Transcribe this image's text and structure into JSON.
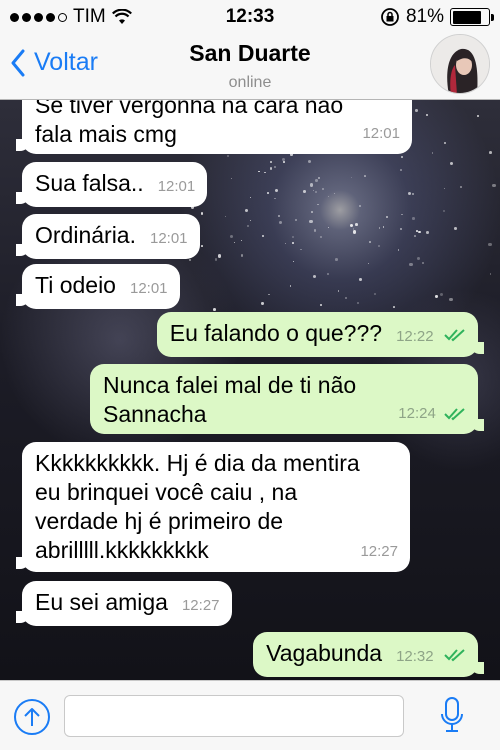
{
  "status_bar": {
    "carrier": "TIM",
    "time": "12:33",
    "battery": "81%",
    "battery_level": 0.81
  },
  "header": {
    "back_label": "Voltar",
    "contact_name": "San Duarte",
    "status": "online"
  },
  "messages": [
    {
      "direction": "in",
      "text": "Se tiver vergonha na cara não fala mais cmg",
      "line1": "Se tiver vergonha na cara não",
      "line2": "fala mais cmg",
      "time": "12:01"
    },
    {
      "direction": "in",
      "text": "Sua falsa..",
      "time": "12:01"
    },
    {
      "direction": "in",
      "text": "Ordinária.",
      "time": "12:01"
    },
    {
      "direction": "in",
      "text": "Ti odeio",
      "time": "12:01"
    },
    {
      "direction": "out",
      "text": "Eu falando o que???",
      "time": "12:22",
      "read": true
    },
    {
      "direction": "out",
      "line1": "Nunca falei mal de ti não",
      "line2": "Sannacha",
      "time": "12:24",
      "read": true
    },
    {
      "direction": "in",
      "line1": "Kkkkkkkkkk. Hj é dia da mentira",
      "line2": "eu brinquei você caiu , na",
      "line3": "verdade hj é primeiro de",
      "line4": "abrilllll.kkkkkkkkk",
      "time": "12:27"
    },
    {
      "direction": "in",
      "text": "Eu sei amiga",
      "time": "12:27"
    },
    {
      "direction": "out",
      "text": "Vagabunda",
      "time": "12:32",
      "read": true
    }
  ],
  "input": {
    "placeholder": ""
  },
  "colors": {
    "accent": "#1a7cf5",
    "incoming_bubble": "#ffffff",
    "outgoing_bubble": "#dcf8c6",
    "read_ticks": "#2fb35c"
  },
  "icons": {
    "signal": "signal-dots-icon",
    "wifi": "wifi-icon",
    "rotation_lock": "rotation-lock-icon",
    "battery": "battery-icon",
    "back": "chevron-left-icon",
    "attach": "upload-arrow-icon",
    "mic": "microphone-icon",
    "read_receipt": "double-check-icon"
  }
}
